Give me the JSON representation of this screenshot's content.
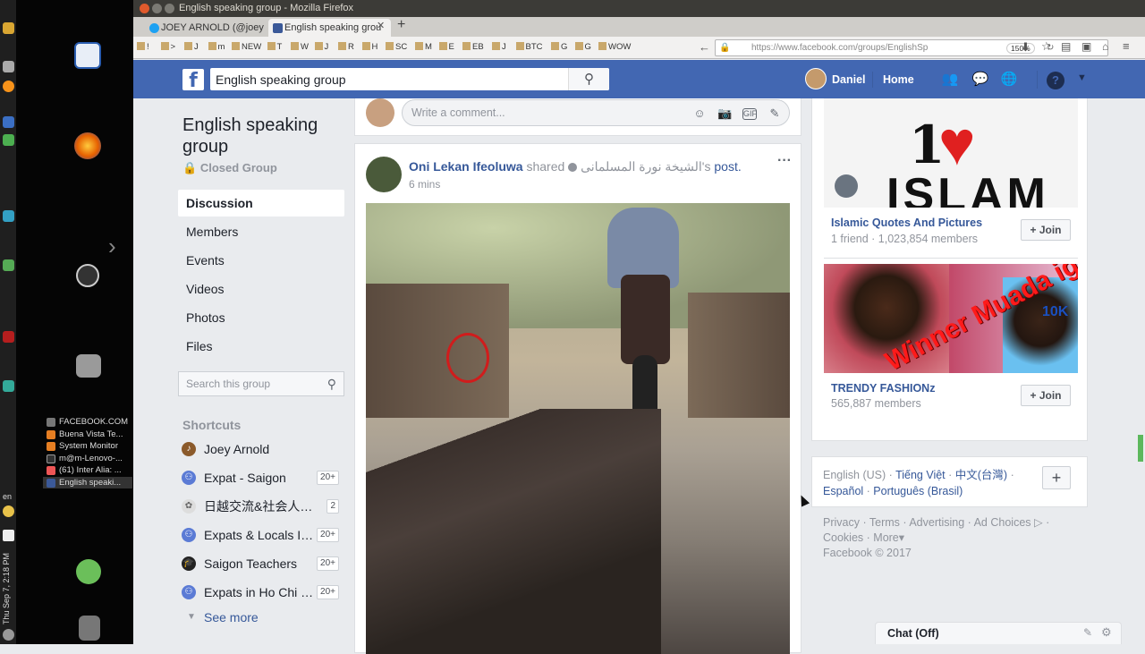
{
  "window": {
    "title": "English speaking group - Mozilla Firefox"
  },
  "tabs": [
    {
      "label": "JOEY ARNOLD (@joey"
    },
    {
      "label": "English speaking grou"
    }
  ],
  "bookmarks": [
    "!",
    ">",
    "J",
    "m",
    "NEW",
    "T",
    "W",
    "J",
    "R",
    "H",
    "SC",
    "M",
    "E",
    "EB",
    "J",
    "BTC",
    "G",
    "G",
    "WOW"
  ],
  "url": {
    "value": "https://www.facebook.com/groups/EnglishSp",
    "zoom": "150%"
  },
  "taskbar": {
    "windows": [
      "FACEBOOK.COM",
      "Buena Vista Te...",
      "System Monitor",
      "m@m-Lenovo-...",
      "(61) Inter Alia: ...",
      "English speaki..."
    ],
    "lang": "en",
    "clock": "Thu Sep 7, 2:18 PM"
  },
  "fb_header": {
    "search_value": "English speaking group",
    "user_name": "Daniel",
    "home_label": "Home"
  },
  "group": {
    "title": "English speaking group",
    "type": "Closed Group",
    "nav": [
      "Discussion",
      "Members",
      "Events",
      "Videos",
      "Photos",
      "Files"
    ],
    "search_placeholder": "Search this group",
    "shortcuts_heading": "Shortcuts",
    "shortcuts": [
      {
        "name": "Joey Arnold",
        "count": ""
      },
      {
        "name": "Expat - Saigon",
        "count": "20+"
      },
      {
        "name": "日越交流&社会人ボ...",
        "count": "2"
      },
      {
        "name": "Expats & Locals In ...",
        "count": "20+"
      },
      {
        "name": "Saigon Teachers",
        "count": "20+"
      },
      {
        "name": "Expats in Ho Chi Mi...",
        "count": "20+"
      }
    ],
    "see_more": "See more"
  },
  "comment": {
    "placeholder": "Write a comment..."
  },
  "post": {
    "author": "Oni Lekan Ifeoluwa",
    "shared_word": "shared",
    "original_author": "الشيخة نورة المسلمانى's",
    "post_word": "post.",
    "time": "6 mins"
  },
  "suggested": [
    {
      "name": "Islamic Quotes And Pictures",
      "meta": "1 friend · 1,023,854 members",
      "join": "Join",
      "image_text": "I ISLAM"
    },
    {
      "name": "TRENDY FASHIONz",
      "meta": "565,887 members",
      "join": "Join",
      "image_text": "Winner Muada igbo",
      "badge": "10K"
    }
  ],
  "languages": {
    "current": "English (US)",
    "others": [
      "Tiếng Việt",
      "中文(台灣)",
      "Español",
      "Português (Brasil)"
    ]
  },
  "footer": {
    "links": [
      "Privacy",
      "Terms",
      "Advertising",
      "Ad Choices",
      "Cookies",
      "More"
    ],
    "copyright": "Facebook © 2017"
  },
  "chat": {
    "label": "Chat (Off)"
  }
}
